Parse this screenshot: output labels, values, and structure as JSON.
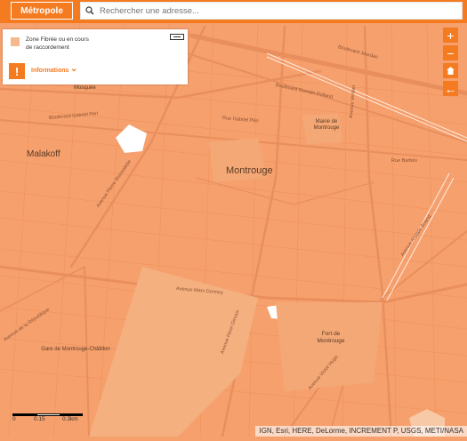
{
  "header": {
    "metropole_label": "Métropole",
    "search_placeholder": "Rechercher une adresse..."
  },
  "legend": {
    "swatch_color": "#f6b98c",
    "item_label": "Zone Fibrée ou en cours de raccordement",
    "info_label": "Informations",
    "info_icon": "!"
  },
  "map_controls": {
    "zoom_in": "+",
    "zoom_out": "−",
    "home": "home-icon",
    "back": "←"
  },
  "places": {
    "malakoff": "Malakoff",
    "montrouge": "Montrouge",
    "mairie": "Mairie de Montrouge",
    "fort": "Fort de Montrouge",
    "gare": "Gare de Montrouge-Châtillon",
    "mosque": "Mosquée"
  },
  "streets": {
    "boulevard_jourdan": "Boulevard Jourdan",
    "boulevard_romain_rolland": "Boulevard Romain Rolland",
    "boulevard_gabriel_peri": "Boulevard Gabriel Péri",
    "rue_gabriel_peri": "Rue Gabriel Péri",
    "rue_barbes": "Rue Barbès",
    "avenue_pierre_brossolette": "Avenue Pierre Brossolette",
    "avenue_marx_dormoy": "Avenue Marx Dormoy",
    "avenue_verdier": "Avenue Verdier",
    "avenue_henri_ginoux": "Avenue Henri Ginoux",
    "avenue_aristide_briand": "Avenue Aristide Briand",
    "avenue_victor_hugo": "Avenue Victor Hugo",
    "avenue_republique": "Avenue de la République"
  },
  "scale": {
    "zero": "0",
    "mid": "0.15",
    "end": "0.3km"
  },
  "attribution": "IGN, Esri, HERE, DeLorme, INCREMENT P, USGS, METI/NASA",
  "colors": {
    "accent": "#f47b20",
    "map_fill": "#f6a06d",
    "road": "#e88f5d",
    "large_parcel": "#f5b080"
  }
}
